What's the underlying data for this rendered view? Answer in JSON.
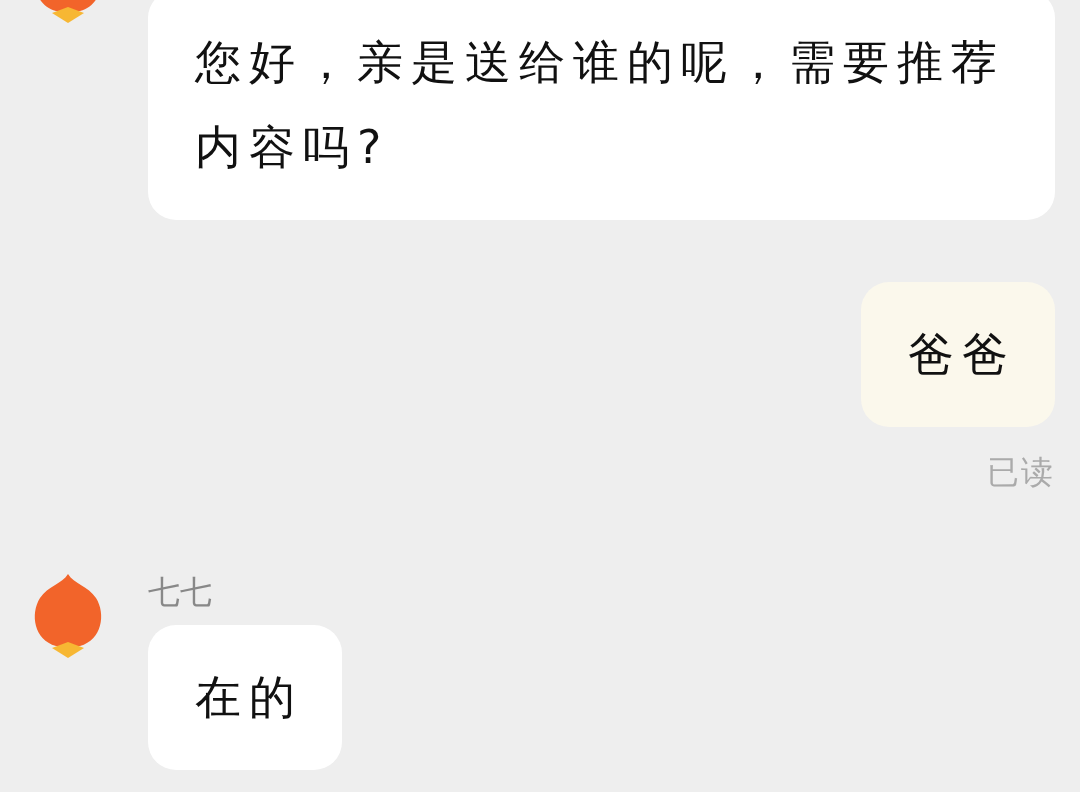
{
  "messages": [
    {
      "kind": "incoming",
      "text": "您好，亲是送给谁的呢，需要推荐内容吗?"
    },
    {
      "kind": "outgoing",
      "text": "爸爸",
      "receipt": "已读"
    },
    {
      "kind": "incoming",
      "sender": "七七",
      "text": "在的"
    }
  ]
}
